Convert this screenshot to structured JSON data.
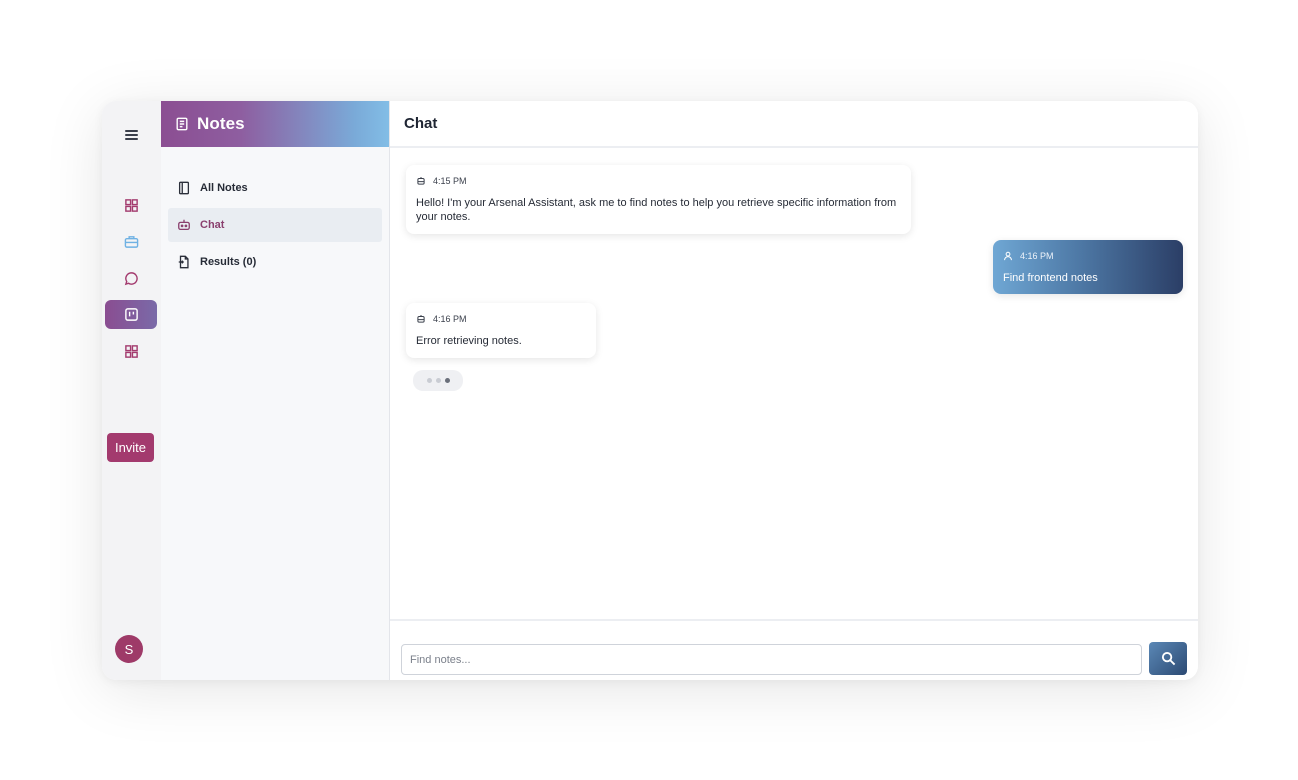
{
  "rail": {
    "icons": [
      "menu-icon",
      "grid-icon",
      "briefcase-icon",
      "chat-bubble-icon",
      "notes-board-icon",
      "grid-icon"
    ],
    "invite_label": "Invite",
    "avatar_initial": "S"
  },
  "sidebar": {
    "title": "Notes",
    "items": [
      {
        "label": "All Notes",
        "icon": "notebook-icon",
        "active": false
      },
      {
        "label": "Chat",
        "icon": "robot-icon",
        "active": true
      },
      {
        "label": "Results (0)",
        "icon": "document-icon",
        "active": false
      }
    ]
  },
  "chat": {
    "title": "Chat",
    "messages": [
      {
        "role": "assistant",
        "time": "4:15 PM",
        "text": "Hello! I'm your Arsenal Assistant, ask me to find notes to help you retrieve specific information from your notes."
      },
      {
        "role": "user",
        "time": "4:16 PM",
        "text": "Find frontend notes"
      },
      {
        "role": "assistant",
        "time": "4:16 PM",
        "text": "Error retrieving notes."
      }
    ],
    "input": {
      "value": "",
      "placeholder": "Find notes..."
    }
  },
  "colors": {
    "accent_purple": "#8a4d91",
    "accent_blue": "#7aaad8",
    "invite": "#a33a6e",
    "user_bubble_dark": "#2b3e66"
  }
}
